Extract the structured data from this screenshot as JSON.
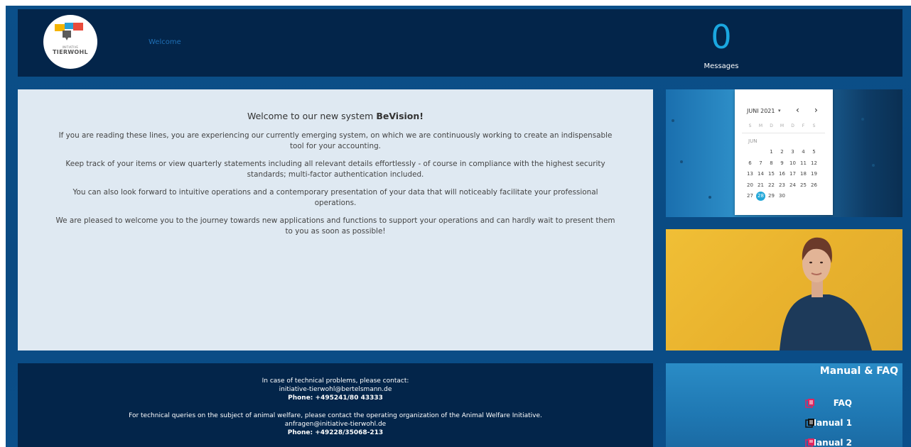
{
  "header": {
    "logo_small": "INITIATIVE",
    "logo_text": "TIERWOHL",
    "welcome_link": "Welcome",
    "messages_count": "0",
    "messages_label": "Messages"
  },
  "welcome": {
    "title_prefix": "Welcome to our new system ",
    "title_brand": "BeVision!",
    "paragraphs": [
      "If you are reading these lines, you are experiencing our currently emerging system, on which we are continuously working to create an indispensable tool for your accounting.",
      "Keep track of your items or view quarterly statements including all relevant details effortlessly - of course in compliance with the highest security standards; multi-factor authentication included.",
      "You can also look forward to intuitive operations and a contemporary presentation of your data that will noticeably facilitate your professional operations.",
      "We are pleased to welcome you to the journey towards new applications and functions to support your operations and can hardly wait to present them to you as soon as possible!"
    ]
  },
  "calendar": {
    "month_year": "JUNI 2021",
    "caret": "▾",
    "prev": "‹",
    "next": "›",
    "weekdays": [
      "S",
      "M",
      "D",
      "M",
      "D",
      "F",
      "S"
    ],
    "month_label": "JUN",
    "rows": [
      [
        "",
        "",
        "1",
        "2",
        "3",
        "4",
        "5"
      ],
      [
        "6",
        "7",
        "8",
        "9",
        "10",
        "11",
        "12"
      ],
      [
        "13",
        "14",
        "15",
        "16",
        "17",
        "18",
        "19"
      ],
      [
        "20",
        "21",
        "22",
        "23",
        "24",
        "25",
        "26"
      ],
      [
        "27",
        "28",
        "29",
        "30",
        "",
        "",
        ""
      ]
    ],
    "today": "28",
    "accent": "#22a7d8"
  },
  "footer": {
    "line1": "In case of technical problems, please contact:",
    "line2": "initiative-tierwohl@bertelsmann.de",
    "line3": "Phone: +495241/80 43333",
    "line4": "For technical queries on the subject of animal welfare, please contact the operating organization of the Animal Welfare Initiative.",
    "line5": "anfragen@initiative-tierwohl.de",
    "line6": "Phone: +49228/35068-213"
  },
  "manual": {
    "title": "Manual & FAQ",
    "items": [
      {
        "label": "FAQ",
        "icon": "document-icon",
        "icon_color": "#e0245e"
      },
      {
        "label": "Manual 1",
        "icon": "document-icon",
        "icon_color": "#111111"
      },
      {
        "label": "Manual 2",
        "icon": "document-icon",
        "icon_color": "#e0245e"
      }
    ]
  }
}
